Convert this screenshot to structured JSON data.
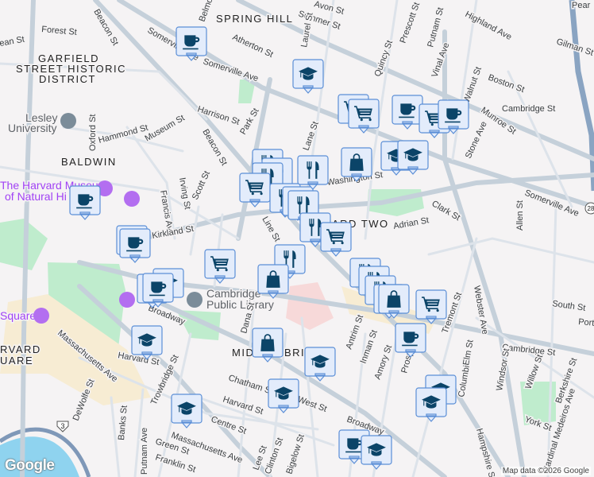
{
  "map": {
    "neighborhoods": [
      "SPRING HILL",
      "GARFIELD",
      "STREET HISTORIC",
      "DISTRICT",
      "BALDWIN",
      "MID",
      "BRI",
      "ARD TWO",
      "RVARD",
      "UARE"
    ],
    "pois": [
      "Lesley",
      "University",
      "The Harvard Museum",
      "of Natural Hi",
      "Cambridge",
      "Public Library",
      "Square"
    ],
    "streets": [
      "Somerville Ave",
      "Beacon St",
      "Forest St",
      "ean St",
      "Summer St",
      "Avon St",
      "Highland Ave",
      "Gilman St",
      "Prescott St",
      "Putnam St",
      "Vinal Ave",
      "Walnut St",
      "Boston St",
      "Munroe St",
      "Atherton St",
      "Somerville Ave",
      "Harrison St",
      "Park St",
      "Museum St",
      "Hammond St",
      "Oxford St",
      "Beacon St",
      "Irving St",
      "Scott St",
      "Francis Ave",
      "Kirkland St",
      "Washington St",
      "Clark St",
      "Adrian St",
      "Stone Ave",
      "Somerville Ave",
      "Allen St",
      "Webster Ave",
      "Tremont St",
      "Cambridge St",
      "South St",
      "Port",
      "Cambridge St",
      "Broadway",
      "Massachusetts Ave",
      "Harvard St",
      "Trowbridge St",
      "Dana St",
      "Chatham St",
      "Harvard St",
      "Centre St",
      "West St",
      "Broadway",
      "Massachusetts Ave",
      "Putnam Ave",
      "Banks St",
      "DeWolfe St",
      "Green St",
      "Franklin St",
      "Lee St",
      "Clinton St",
      "Bigelow St",
      "Antrim St",
      "Inman St",
      "Amory St",
      "Prospect St",
      "Columbia St",
      "Elm St",
      "Windsor St",
      "Willow St",
      "Berkshire St",
      "York St",
      "Hampshire St",
      "Cardinal Medeiros Ave",
      "Line St",
      "Belmont",
      "Laurel St",
      "Quincy St",
      "Lane St",
      "Oxford St",
      "Pear",
      "Broadway"
    ],
    "route_shield": "3",
    "route_shield2": "28",
    "logo": "Google",
    "credit": "Map data ©2026 Google"
  },
  "markers": [
    "cafe",
    "education",
    "shopping",
    "shopping",
    "cafe",
    "shopping",
    "cafe",
    "education",
    "education",
    "bag",
    "restaurant",
    "restaurant",
    "restaurant",
    "shopping",
    "restaurant",
    "restaurant",
    "restaurant",
    "restaurant",
    "restaurant",
    "shopping",
    "cafe",
    "cafe",
    "cafe",
    "shopping",
    "education",
    "cafe",
    "cafe",
    "restaurant",
    "bag",
    "restaurant",
    "restaurant",
    "restaurant",
    "bag",
    "bag",
    "shopping",
    "cafe",
    "education",
    "bag",
    "education",
    "education",
    "education",
    "education",
    "education",
    "cafe",
    "education"
  ],
  "colors": {
    "marker_fill": "#e3ecfb",
    "marker_border": "#5b8ed6",
    "icon": "#0b4468",
    "park": "#b7ebc8",
    "water": "#8fd3ef",
    "highway": "#8aa4c2"
  }
}
